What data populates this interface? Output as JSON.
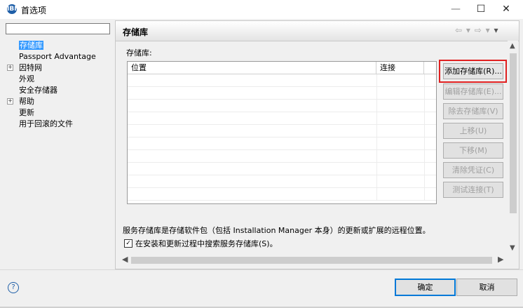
{
  "window": {
    "title": "首选项",
    "app_icon_glyph": "IBM",
    "controls": {
      "minimize": "—",
      "maximize": "☐",
      "close": "✕"
    }
  },
  "sidebar": {
    "filter_value": "",
    "items": [
      {
        "label": "存储库",
        "selected": true,
        "expandable": false
      },
      {
        "label": "Passport Advantage",
        "selected": false,
        "expandable": false
      },
      {
        "label": "因特网",
        "selected": false,
        "expandable": true
      },
      {
        "label": "外观",
        "selected": false,
        "expandable": false
      },
      {
        "label": "安全存储器",
        "selected": false,
        "expandable": false
      },
      {
        "label": "帮助",
        "selected": false,
        "expandable": true
      },
      {
        "label": "更新",
        "selected": false,
        "expandable": false
      },
      {
        "label": "用于回滚的文件",
        "selected": false,
        "expandable": false
      }
    ]
  },
  "panel": {
    "title": "存储库",
    "nav_glyphs": [
      "⇦",
      "▾",
      "⇨",
      "▾",
      "▾"
    ],
    "repositories_label": "存储库:",
    "table": {
      "columns": [
        "位置",
        "连接"
      ],
      "rows": []
    },
    "buttons": [
      {
        "label": "添加存储库(R)...",
        "enabled": true
      },
      {
        "label": "编辑存储库(E)...",
        "enabled": false
      },
      {
        "label": "除去存储库(V)",
        "enabled": false
      },
      {
        "label": "上移(U)",
        "enabled": false
      },
      {
        "label": "下移(M)",
        "enabled": false
      },
      {
        "label": "清除凭证(C)",
        "enabled": false
      },
      {
        "label": "测试连接(T)",
        "enabled": false
      }
    ],
    "description": "服务存储库是存储软件包（包括 Installation Manager 本身）的更新或扩展的远程位置。",
    "search_checkbox": {
      "checked": true,
      "label": "在安装和更新过程中搜索服务存储库(S)。"
    }
  },
  "footer": {
    "help_glyph": "?",
    "ok_label": "确定",
    "cancel_label": "取消"
  },
  "colors": {
    "selection": "#3399ff",
    "highlight_border": "#e02020",
    "default_button_border": "#0078d7"
  }
}
